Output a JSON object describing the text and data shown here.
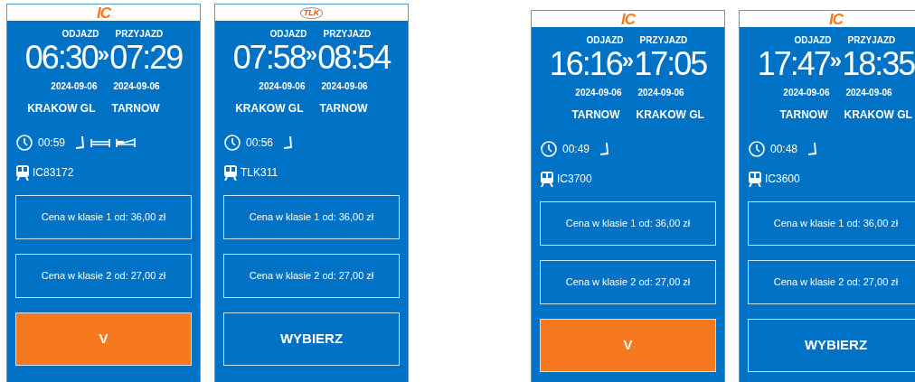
{
  "groups": [
    {
      "cards": [
        {
          "logo": {
            "kind": "ic",
            "text": "IC"
          },
          "departure_label": "ODJAZD",
          "arrival_label": "PRZYJAZD",
          "departure_time": "06:30",
          "separator": "»",
          "arrival_time": "07:29",
          "departure_date": "2024-09-06",
          "arrival_date": "2024-09-06",
          "from": "KRAKOW GL",
          "to": "TARNOW",
          "duration": "00:59",
          "amenities": [
            {
              "kind": "seat"
            },
            {
              "kind": "couchette"
            },
            {
              "kind": "sleeper"
            }
          ],
          "train": "IC83172",
          "prices": [
            "Cena w klasie 1 od: 36,00 zł",
            "Cena w klasie 2 od: 27,00 zł"
          ],
          "button": {
            "label": "V",
            "selected": true
          }
        },
        {
          "logo": {
            "kind": "tlk",
            "text": "TLK"
          },
          "departure_label": "ODJAZD",
          "arrival_label": "PRZYJAZD",
          "departure_time": "07:58",
          "separator": "»",
          "arrival_time": "08:54",
          "departure_date": "2024-09-06",
          "arrival_date": "2024-09-06",
          "from": "KRAKOW GL",
          "to": "TARNOW",
          "duration": "00:56",
          "amenities": [
            {
              "kind": "seat"
            }
          ],
          "train": "TLK311",
          "prices": [
            "Cena w klasie 1 od: 36,00 zł",
            "Cena w klasie 2 od: 27,00 zł"
          ],
          "button": {
            "label": "WYBIERZ",
            "selected": false
          }
        }
      ]
    },
    {
      "cards": [
        {
          "logo": {
            "kind": "ic",
            "text": "IC"
          },
          "departure_label": "ODJAZD",
          "arrival_label": "PRZYJAZD",
          "departure_time": "16:16",
          "separator": "»",
          "arrival_time": "17:05",
          "departure_date": "2024-09-06",
          "arrival_date": "2024-09-06",
          "from": "TARNOW",
          "to": "KRAKOW GL",
          "duration": "00:49",
          "amenities": [
            {
              "kind": "seat"
            }
          ],
          "train": "IC3700",
          "prices": [
            "Cena w klasie 1 od: 36,00 zł",
            "Cena w klasie 2 od: 27,00 zł"
          ],
          "button": {
            "label": "V",
            "selected": true
          }
        },
        {
          "logo": {
            "kind": "ic",
            "text": "IC"
          },
          "departure_label": "ODJAZD",
          "arrival_label": "PRZYJAZD",
          "departure_time": "17:47",
          "separator": "»",
          "arrival_time": "18:35",
          "departure_date": "2024-09-06",
          "arrival_date": "2024-09-06",
          "from": "TARNOW",
          "to": "KRAKOW GL",
          "duration": "00:48",
          "amenities": [
            {
              "kind": "seat"
            }
          ],
          "train": "IC3600",
          "prices": [
            "Cena w klasie 1 od: 36,00 zł",
            "Cena w klasie 2 od: 27,00 zł"
          ],
          "button": {
            "label": "WYBIERZ",
            "selected": false
          }
        }
      ]
    }
  ]
}
